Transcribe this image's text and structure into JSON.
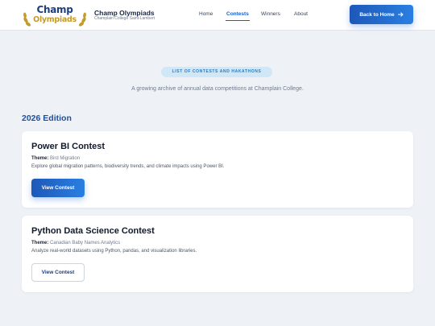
{
  "brand": {
    "logo_line1": "Champ",
    "logo_line2": "Olympiads",
    "title": "Champ Olympiads",
    "subtitle": "Champlain College Saint-Lambert"
  },
  "nav": {
    "items": [
      {
        "label": "Home",
        "active": false
      },
      {
        "label": "Contests",
        "active": true
      },
      {
        "label": "Winners",
        "active": false
      },
      {
        "label": "About",
        "active": false
      }
    ],
    "back_label": "Back to Home",
    "back_icon": "arrow-right-icon"
  },
  "hero": {
    "pill": "LIST OF CONTESTS AND HAKATHONS",
    "subtitle": "A growing archive of annual data competitions at Champlain College."
  },
  "edition": "2026 Edition",
  "contests": [
    {
      "title": "Power BI Contest",
      "theme_label": "Theme:",
      "theme": "Bird Migration",
      "description": "Explore global migration patterns, biodiversity trends, and climate impacts using Power BI.",
      "button": "View Contest",
      "button_style": "primary"
    },
    {
      "title": "Python Data Science Contest",
      "theme_label": "Theme:",
      "theme": "Canadian Baby Names Analytics",
      "description": "Analyze real-world datasets using Python, pandas, and visualization libraries.",
      "button": "View Contest",
      "button_style": "outline"
    }
  ],
  "colors": {
    "accent": "#1a5fc7",
    "gold": "#c49a2a",
    "background": "#eef2f7"
  }
}
